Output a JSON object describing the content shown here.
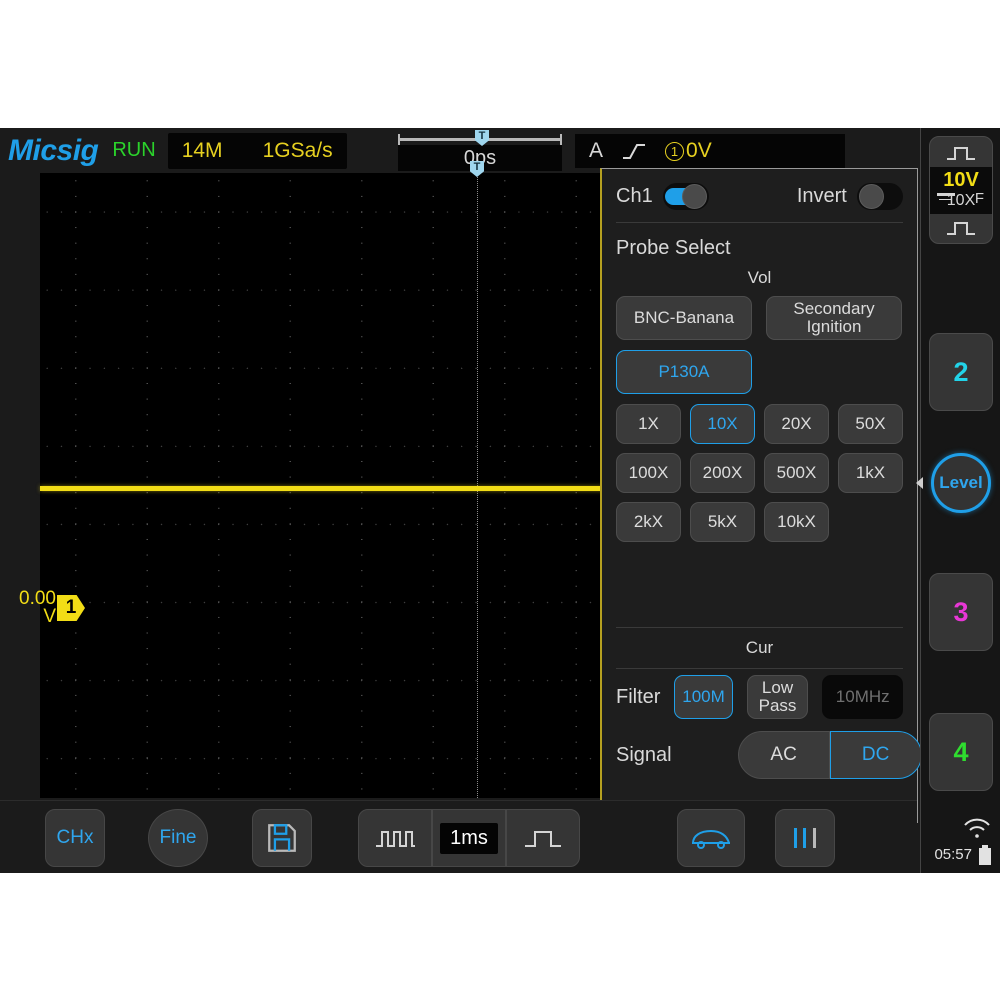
{
  "brand": "Micsig",
  "status": {
    "run_state": "RUN",
    "memory_depth": "14M",
    "sample_rate": "1GSa/s",
    "trigger_position": "0ps",
    "trigger_mode": "A",
    "trigger_edge_icon": "rising-edge-icon",
    "trigger_source": "1",
    "trigger_level": "0V",
    "clock": "05:57",
    "wifi_icon": "wifi-icon",
    "battery_icon": "battery-icon"
  },
  "waveform": {
    "channel_tag": "1",
    "offset_value": "0.00",
    "offset_unit": "V",
    "trace_color": "#f2dd16",
    "trigger_marker": "T"
  },
  "panel": {
    "channel_label": "Ch1",
    "channel_enabled": true,
    "invert_label": "Invert",
    "invert_enabled": false,
    "probe_select_title": "Probe Select",
    "vol_label": "Vol",
    "probe_types": [
      {
        "label": "BNC-Banana",
        "selected": false
      },
      {
        "label": "Secondary Ignition",
        "selected": false
      },
      {
        "label": "P130A",
        "selected": true
      }
    ],
    "attenuations": [
      {
        "label": "1X",
        "selected": false
      },
      {
        "label": "10X",
        "selected": true
      },
      {
        "label": "20X",
        "selected": false
      },
      {
        "label": "50X",
        "selected": false
      },
      {
        "label": "100X",
        "selected": false
      },
      {
        "label": "200X",
        "selected": false
      },
      {
        "label": "500X",
        "selected": false
      },
      {
        "label": "1kX",
        "selected": false
      },
      {
        "label": "2kX",
        "selected": false
      },
      {
        "label": "5kX",
        "selected": false
      },
      {
        "label": "10kX",
        "selected": false
      }
    ],
    "cur_label": "Cur",
    "filter_label": "Filter",
    "filters": [
      {
        "label": "100M",
        "selected": true,
        "disabled": false
      },
      {
        "label": "Low Pass",
        "selected": false,
        "disabled": false
      },
      {
        "label": "10MHz",
        "selected": false,
        "disabled": true
      }
    ],
    "signal_label": "Signal",
    "coupling": [
      {
        "label": "AC",
        "selected": false
      },
      {
        "label": "DC",
        "selected": true
      }
    ]
  },
  "rail": {
    "ch1": {
      "volts_div": "10V",
      "coupling_icon": "dc-coupling-icon",
      "bandwidth_flag": "F",
      "probe_ratio": "10X",
      "pulse_icon": "pulse-icon"
    },
    "level_label": "Level",
    "channels": [
      {
        "label": "2",
        "color": "#22d3e8"
      },
      {
        "label": "3",
        "color": "#e837d6"
      },
      {
        "label": "4",
        "color": "#2fdd2f"
      }
    ]
  },
  "bottom": {
    "chx_label": "CHx",
    "fine_label": "Fine",
    "save_icon": "save-disk-icon",
    "timebase_decrease_icon": "narrow-pulse-icon",
    "timebase_value": "1ms",
    "timebase_increase_icon": "wide-pulse-icon",
    "car_icon": "car-icon",
    "bars_icon": "vertical-bars-icon"
  },
  "colors": {
    "accent_blue": "#1f9fe8",
    "channel1_yellow": "#f2dd16",
    "run_green": "#2bd22b",
    "panel_border": "#b5a020"
  }
}
